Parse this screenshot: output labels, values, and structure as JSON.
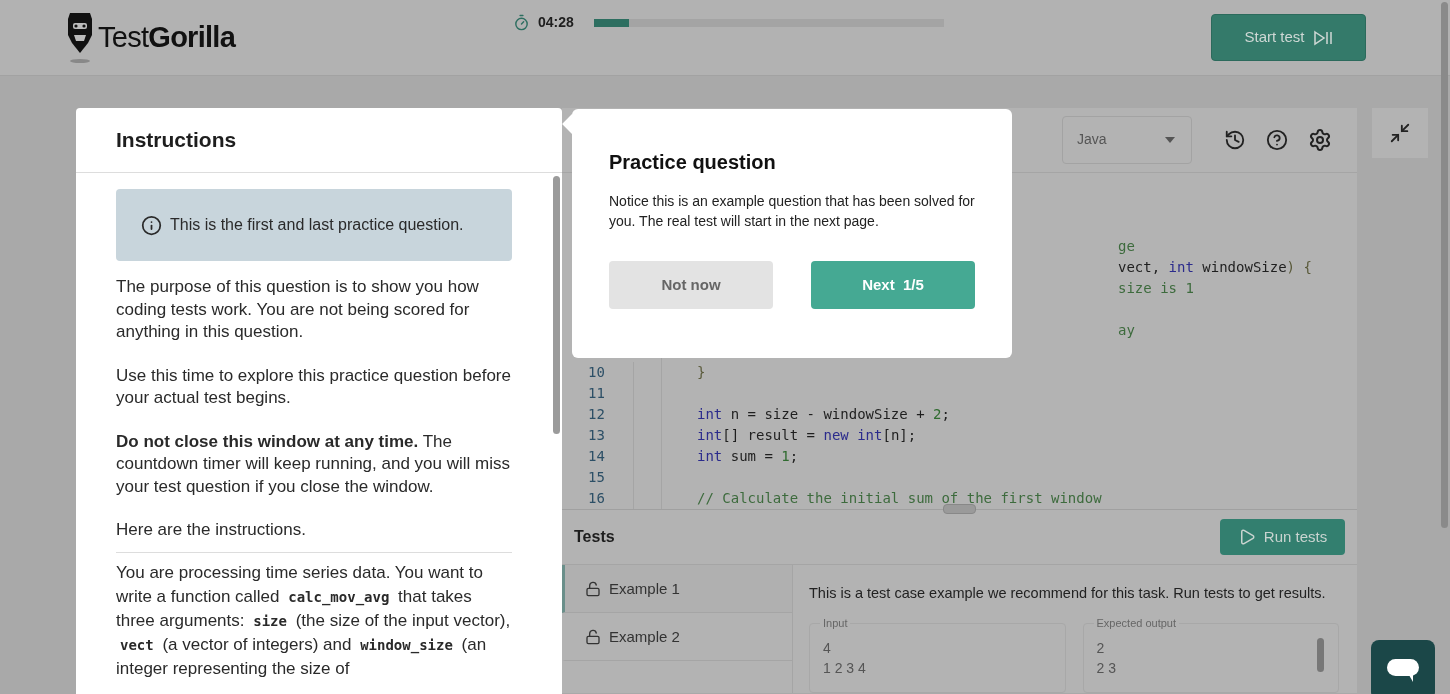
{
  "header": {
    "logo": {
      "light": "Test",
      "bold": "Gorilla"
    },
    "timer": {
      "time": "04:28",
      "level": 0.1
    },
    "start_button": "Start test"
  },
  "instructions": {
    "title": "Instructions",
    "notice": "This is the first and last practice question.",
    "paragraphs": [
      "The purpose of this question is to show you how coding tests work. You are not being scored for anything in this question.",
      "Use this time to explore this practice question before your actual test begins.",
      "**Do not close this window at any time.** The countdown timer will keep running, and you will miss your test question if you close the window.",
      "Here are the instructions."
    ],
    "task": [
      {
        "text": "You are processing time series data. You want to write a function called ",
        "code": false
      },
      {
        "text": "calc_mov_avg",
        "code": true
      },
      {
        "text": " that takes three arguments: ",
        "code": false
      },
      {
        "text": "size",
        "code": true
      },
      {
        "text": " (the size of the input vector), ",
        "code": false
      },
      {
        "text": "vect",
        "code": true
      },
      {
        "text": " (a vector of integers) and ",
        "code": false
      },
      {
        "text": "window_size",
        "code": true
      },
      {
        "text": " (an integer representing the size of",
        "code": false
      }
    ]
  },
  "editor": {
    "language": "Java",
    "covered_groups": [
      [
        {
          "tokens": [
            {
              "text": "ge",
              "kind": "comment"
            }
          ]
        },
        {
          "tokens": [
            {
              "text": "vect, ",
              "kind": "plain"
            },
            {
              "text": "int",
              "kind": "keyword"
            },
            {
              "text": " windowSize",
              "kind": "plain"
            },
            {
              "text": ") {",
              "kind": "bracket"
            }
          ]
        },
        {
          "tokens": [
            {
              "text": "size is 1",
              "kind": "comment"
            }
          ]
        }
      ],
      [
        {
          "tokens": [
            {
              "text": "ay",
              "kind": "comment"
            }
          ]
        }
      ]
    ],
    "code_lines": [
      {
        "number": "10",
        "tokens": [
          {
            "text": "}",
            "kind": "bracket"
          }
        ]
      },
      {
        "number": "11"
      },
      {
        "number": "12",
        "tokens": [
          {
            "text": "int",
            "kind": "keyword"
          },
          {
            "text": " n = size - windowSize + ",
            "kind": "plain"
          },
          {
            "text": "2",
            "kind": "number"
          },
          {
            "text": ";",
            "kind": "plain"
          }
        ]
      },
      {
        "number": "13",
        "tokens": [
          {
            "text": "int",
            "kind": "keyword"
          },
          {
            "text": "[] result = ",
            "kind": "plain"
          },
          {
            "text": "new",
            "kind": "keyword"
          },
          {
            "text": " int",
            "kind": "keyword"
          },
          {
            "text": "[n];",
            "kind": "plain"
          }
        ]
      },
      {
        "number": "14",
        "tokens": [
          {
            "text": "int",
            "kind": "keyword"
          },
          {
            "text": " sum = ",
            "kind": "plain"
          },
          {
            "text": "1",
            "kind": "number"
          },
          {
            "text": ";",
            "kind": "plain"
          }
        ]
      },
      {
        "number": "15"
      },
      {
        "number": "16",
        "tokens": [
          {
            "text": "// Calculate the initial sum of the first window",
            "kind": "comment"
          }
        ]
      }
    ]
  },
  "tests": {
    "title": "Tests",
    "run_button": "Run tests",
    "examples": [
      {
        "label": "Example 1",
        "selected": true
      },
      {
        "label": "Example 2",
        "selected": false
      }
    ],
    "description": "This is a test case example we recommend for this task. Run tests to get results.",
    "input": {
      "label": "Input",
      "lines": [
        "4",
        "1 2 3 4"
      ]
    },
    "expected": {
      "label": "Expected output",
      "lines": [
        "2",
        "2 3"
      ]
    }
  },
  "popover": {
    "title": "Practice question",
    "text": "Notice this is an example question that has been solved for you. The real test will start in the next page.",
    "dismiss": "Not now",
    "next": "Next  1/5"
  }
}
